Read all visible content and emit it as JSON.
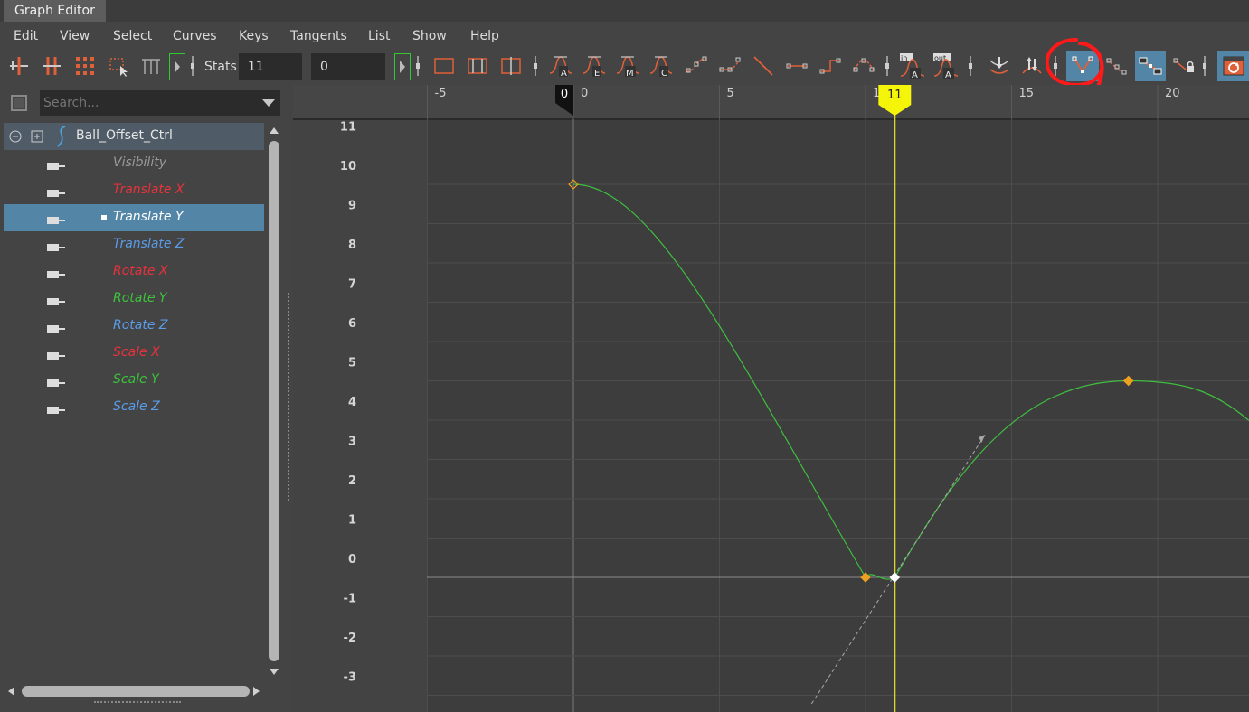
{
  "window": {
    "title": "Graph Editor"
  },
  "menu": [
    "Edit",
    "View",
    "Select",
    "Curves",
    "Keys",
    "Tangents",
    "List",
    "Show",
    "Help"
  ],
  "toolbar": {
    "stats_label": "Stats",
    "frame_value": "11",
    "value_value": "0",
    "icons": [
      "move-key-icon",
      "insert-key-icon",
      "lattice-deform-icon",
      "region-select-icon",
      "retime-icon",
      "frame-all-icon",
      "frame-playback-icon",
      "center-current-icon",
      "auto-tangent-icon",
      "spline-tangent-icon",
      "clamped-tangent-icon",
      "linear-tangent-icon",
      "flat-tangent-icon",
      "step-tangent-icon",
      "plateau-tangent-icon",
      "default-in-tangent-icon",
      "default-out-tangent-icon",
      "buffer-curve-snapshot-icon",
      "swap-buffer-icon",
      "break-tangents-icon",
      "unify-tangents-icon",
      "free-tangent-weight-icon",
      "lock-tangent-weight-icon",
      "curve-refresh-icon"
    ],
    "in_label": "in",
    "out_label": "out",
    "colors": {
      "active": "#5285a6",
      "accent": "#e0603a",
      "annotation": "#ff1a1a"
    }
  },
  "outliner": {
    "search_placeholder": "Search...",
    "node": "Ball_Offset_Ctrl",
    "attributes": [
      {
        "label": "Visibility",
        "color": "#9a9a9a",
        "selected": false
      },
      {
        "label": "Translate X",
        "color": "#e8323c",
        "selected": false
      },
      {
        "label": "Translate Y",
        "color": "#ffffff",
        "selected": true
      },
      {
        "label": "Translate Z",
        "color": "#5a9ce8",
        "selected": false
      },
      {
        "label": "Rotate X",
        "color": "#e8323c",
        "selected": false
      },
      {
        "label": "Rotate Y",
        "color": "#3cc43c",
        "selected": false
      },
      {
        "label": "Rotate Z",
        "color": "#5a9ce8",
        "selected": false
      },
      {
        "label": "Scale X",
        "color": "#e8323c",
        "selected": false
      },
      {
        "label": "Scale Y",
        "color": "#3cc43c",
        "selected": false
      },
      {
        "label": "Scale Z",
        "color": "#5a9ce8",
        "selected": false
      }
    ]
  },
  "graph": {
    "x_ticks": [
      "-5",
      "0",
      "5",
      "10",
      "15",
      "20"
    ],
    "y_ticks": [
      "11",
      "10",
      "9",
      "8",
      "7",
      "6",
      "5",
      "4",
      "3",
      "2",
      "1",
      "0",
      "-1",
      "-2",
      "-3"
    ],
    "start_marker": "0",
    "current_frame": "11",
    "keys": [
      {
        "frame": 0,
        "value": 10
      },
      {
        "frame": 10,
        "value": 0
      },
      {
        "frame": 11,
        "value": 0
      },
      {
        "frame": 19,
        "value": 5
      }
    ],
    "curve_color": "#3fbf3f"
  }
}
